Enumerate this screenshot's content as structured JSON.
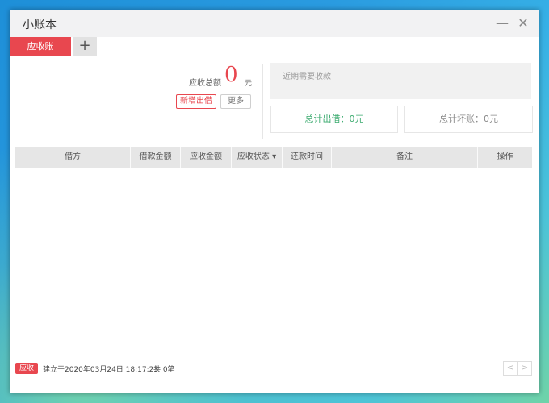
{
  "window": {
    "title": "小账本",
    "minimize_glyph": "—",
    "close_glyph": "✕"
  },
  "tabs": {
    "active_label": "应收账",
    "add_glyph": "+"
  },
  "summary": {
    "total_label": "应收总额",
    "total_value": "0",
    "unit": "元",
    "new_button": "新增出借",
    "more_button": "更多"
  },
  "recent": {
    "label": "近期需要收款"
  },
  "stats": {
    "lent_total": "总计出借：0元",
    "bad_debt_total": "总计坏账：0元"
  },
  "table": {
    "columns": [
      "借方",
      "借款金额",
      "应收金额",
      "应收状态 ▾",
      "还款时间",
      "备注",
      "操作"
    ],
    "rows": []
  },
  "footer": {
    "badge": "应收",
    "created": "建立于2020年03月24日 18:17:23",
    "count": "共 0笔",
    "prev": "<",
    "next": ">"
  },
  "colors": {
    "accent": "#e8474f",
    "green": "#3aaa6e",
    "header_bg": "#e6e6e6"
  }
}
